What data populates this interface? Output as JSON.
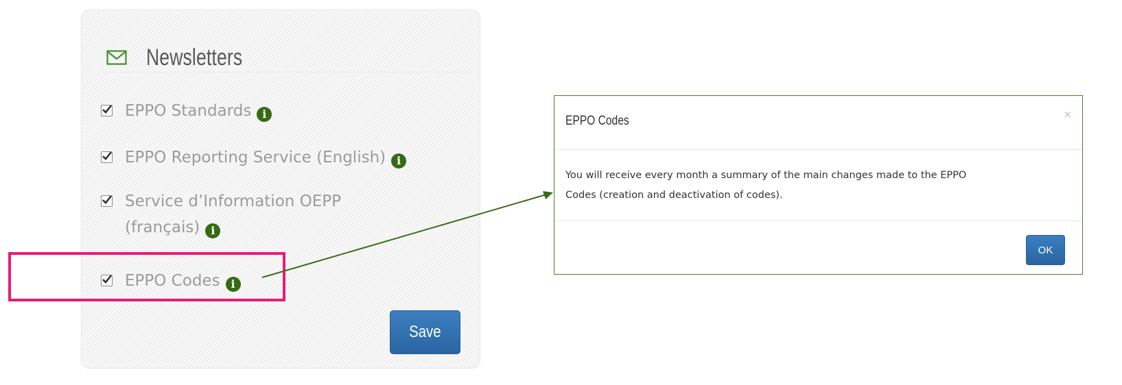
{
  "panel": {
    "title": "Newsletters",
    "options": [
      {
        "label": "EPPO Standards",
        "checked": true
      },
      {
        "label": "EPPO Reporting Service (English)",
        "checked": true
      },
      {
        "label_line1": "Service d’Information OEPP",
        "label_line2": "(français)",
        "checked": true
      },
      {
        "label": "EPPO Codes",
        "checked": true
      }
    ],
    "info_icon": "info-circle-icon",
    "header_icon": "envelope-icon",
    "save_label": "Save"
  },
  "modal": {
    "title": "EPPO Codes",
    "close_label": "×",
    "body_line1": "You will receive every month a summary of the main changes made to the EPPO",
    "body_line2": "Codes (creation and deactivation of codes).",
    "ok_label": "OK"
  },
  "colors": {
    "info_icon": "#346b14",
    "highlight": "#ea1a76",
    "connector": "#3b6a1a",
    "button": "#2f6eae"
  }
}
